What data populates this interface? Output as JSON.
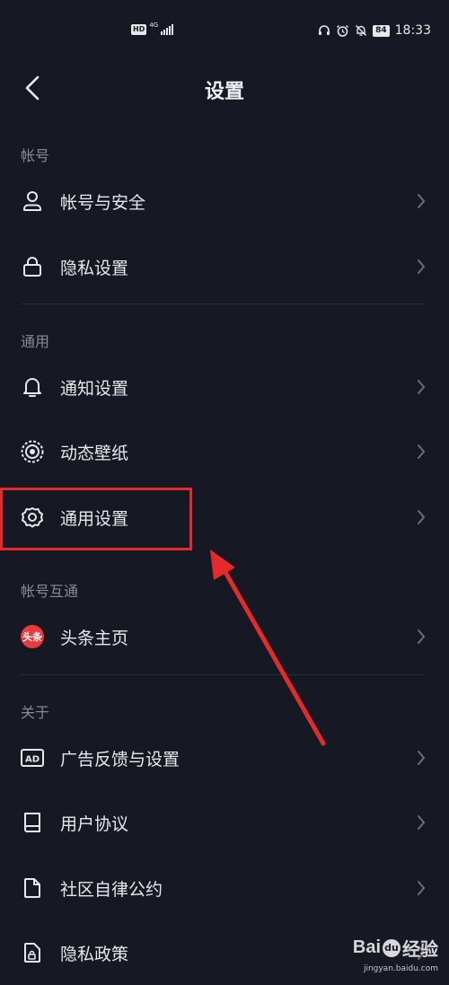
{
  "status_bar": {
    "hd": "HD",
    "network": "4G",
    "battery": "84",
    "time": "18:33"
  },
  "nav": {
    "title": "设置"
  },
  "sections": [
    {
      "header": "帐号",
      "items": [
        {
          "label": "帐号与安全",
          "icon": "user-icon"
        },
        {
          "label": "隐私设置",
          "icon": "lock-icon"
        }
      ]
    },
    {
      "header": "通用",
      "items": [
        {
          "label": "通知设置",
          "icon": "bell-icon"
        },
        {
          "label": "动态壁纸",
          "icon": "live-wallpaper-icon"
        },
        {
          "label": "通用设置",
          "icon": "gear-icon"
        }
      ]
    },
    {
      "header": "帐号互通",
      "items": [
        {
          "label": "头条主页",
          "icon": "toutiao-logo",
          "logo_text": "头条"
        }
      ]
    },
    {
      "header": "关于",
      "items": [
        {
          "label": "广告反馈与设置",
          "icon": "ad-icon",
          "icon_text": "AD"
        },
        {
          "label": "用户协议",
          "icon": "book-icon"
        },
        {
          "label": "社区自律公约",
          "icon": "document-icon"
        },
        {
          "label": "隐私政策",
          "icon": "privacy-document-icon"
        }
      ]
    }
  ],
  "watermark": {
    "logo": "Bai",
    "logo_suffix": "经验",
    "sub": "jingyan.baidu.com"
  },
  "colors": {
    "background": "#161823",
    "text": "#e8e8ea",
    "section_header": "#8a8b91",
    "highlight": "#e62a2a",
    "toutiao_red": "#ea3b3b"
  }
}
